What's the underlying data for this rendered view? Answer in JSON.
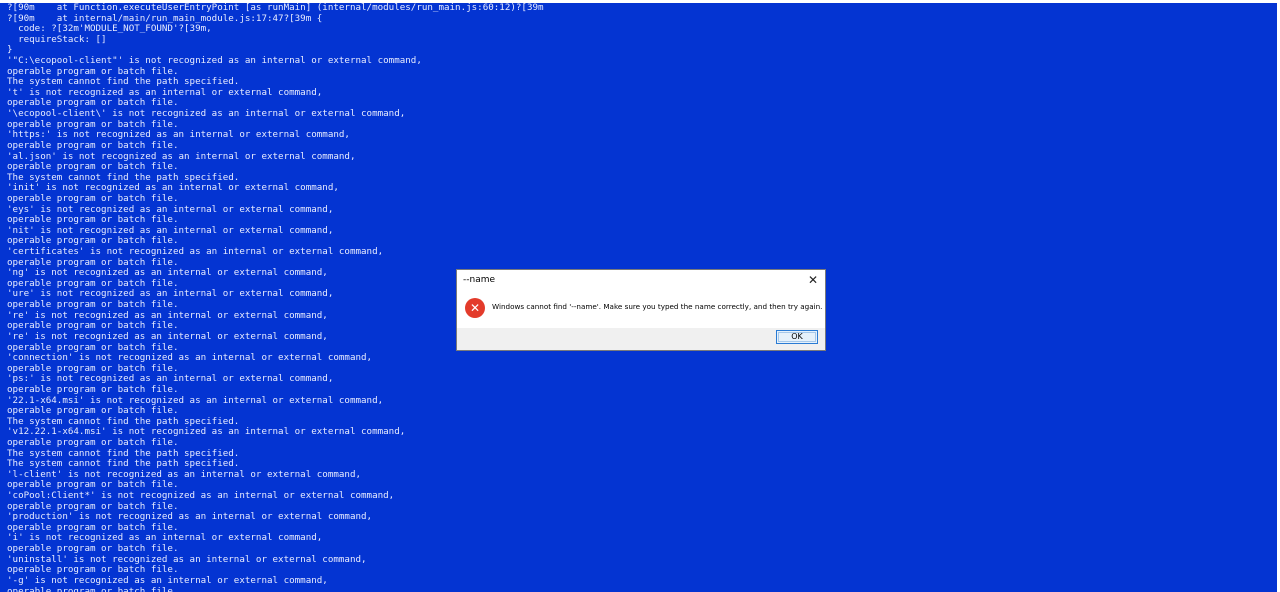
{
  "console": {
    "lines": [
      "?[90m    at Function.executeUserEntryPoint [as runMain] (internal/modules/run_main.js:60:12)?[39m",
      "?[90m    at internal/main/run_main_module.js:17:47?[39m {",
      "  code: ?[32m'MODULE_NOT_FOUND'?[39m,",
      "  requireStack: []",
      "}",
      "'\"C:\\ecopool-client\"' is not recognized as an internal or external command,",
      "operable program or batch file.",
      "The system cannot find the path specified.",
      "'t' is not recognized as an internal or external command,",
      "operable program or batch file.",
      "'\\ecopool-client\\' is not recognized as an internal or external command,",
      "operable program or batch file.",
      "'https:' is not recognized as an internal or external command,",
      "operable program or batch file.",
      "'al.json' is not recognized as an internal or external command,",
      "operable program or batch file.",
      "The system cannot find the path specified.",
      "'init' is not recognized as an internal or external command,",
      "operable program or batch file.",
      "'eys' is not recognized as an internal or external command,",
      "operable program or batch file.",
      "'nit' is not recognized as an internal or external command,",
      "operable program or batch file.",
      "'certificates' is not recognized as an internal or external command,",
      "operable program or batch file.",
      "'ng' is not recognized as an internal or external command,",
      "operable program or batch file.",
      "'ure' is not recognized as an internal or external command,",
      "operable program or batch file.",
      "'re' is not recognized as an internal or external command,",
      "operable program or batch file.",
      "'re' is not recognized as an internal or external command,",
      "operable program or batch file.",
      "'connection' is not recognized as an internal or external command,",
      "operable program or batch file.",
      "'ps:' is not recognized as an internal or external command,",
      "operable program or batch file.",
      "'22.1-x64.msi' is not recognized as an internal or external command,",
      "operable program or batch file.",
      "The system cannot find the path specified.",
      "'v12.22.1-x64.msi' is not recognized as an internal or external command,",
      "operable program or batch file.",
      "The system cannot find the path specified.",
      "The system cannot find the path specified.",
      "'l-client' is not recognized as an internal or external command,",
      "operable program or batch file.",
      "'coPool:Client*' is not recognized as an internal or external command,",
      "operable program or batch file.",
      "'production' is not recognized as an internal or external command,",
      "operable program or batch file.",
      "'i' is not recognized as an internal or external command,",
      "operable program or batch file.",
      "'uninstall' is not recognized as an internal or external command,",
      "operable program or batch file.",
      "'-g' is not recognized as an internal or external command,",
      "operable program or batch file."
    ]
  },
  "dialog": {
    "title": "--name",
    "close_glyph": "✕",
    "icon": "error-icon",
    "icon_glyph": "✕",
    "message": "Windows cannot find '--name'. Make sure you typed the name correctly, and then try again.",
    "ok_label": "OK"
  },
  "colors": {
    "console_background": "#0434d2",
    "console_text": "#e8ecff",
    "error_icon": "#e33b2b"
  }
}
